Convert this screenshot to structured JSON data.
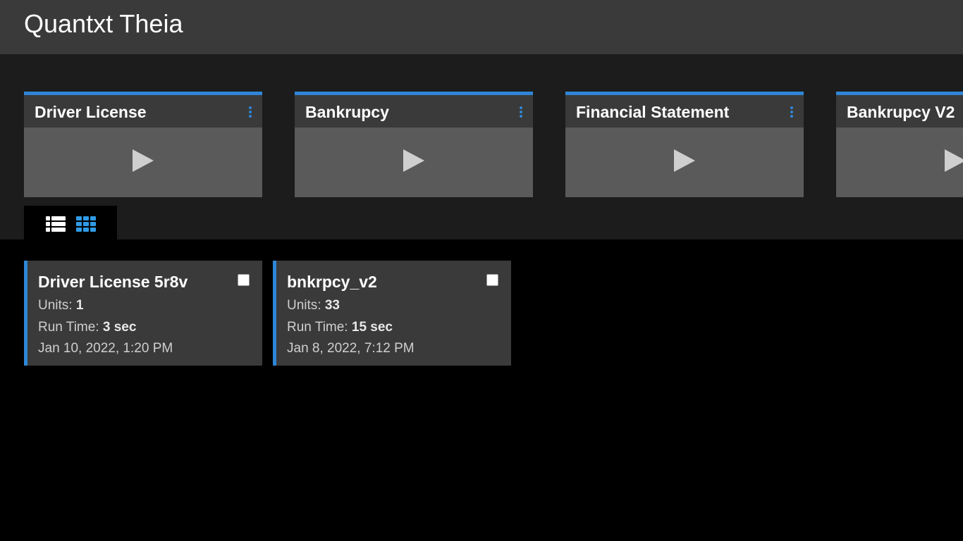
{
  "header": {
    "title": "Quantxt Theia"
  },
  "templates": [
    {
      "name": "Driver License",
      "menu_icon": "kebab-icon",
      "action_icon": "play-icon"
    },
    {
      "name": "Bankrupcy",
      "menu_icon": "kebab-icon",
      "action_icon": "play-icon"
    },
    {
      "name": "Financial Statement",
      "menu_icon": "kebab-icon",
      "action_icon": "play-icon"
    },
    {
      "name": "Bankrupcy V2",
      "menu_icon": "kebab-icon",
      "action_icon": "play-icon"
    }
  ],
  "view_toggle": {
    "list_icon": "list-view-icon",
    "grid_icon": "grid-view-icon",
    "active": "grid"
  },
  "results": [
    {
      "title": "Driver License 5r8v",
      "units_label": "Units: ",
      "units_value": "1",
      "runtime_label": "Run Time: ",
      "runtime_value": "3 sec",
      "date": "Jan 10, 2022, 1:20 PM",
      "checked": false
    },
    {
      "title": "bnkrpcy_v2",
      "units_label": "Units: ",
      "units_value": "33",
      "runtime_label": "Run Time: ",
      "runtime_value": "15 sec",
      "date": "Jan 8, 2022, 7:12 PM",
      "checked": false
    }
  ],
  "colors": {
    "accent": "#2f86d6",
    "header_bg": "#3a3a3a",
    "band_bg": "#1c1c1c",
    "card_bg": "#3a3a3a",
    "card_body_bg": "#5a5a5a",
    "page_bg": "#000000"
  }
}
